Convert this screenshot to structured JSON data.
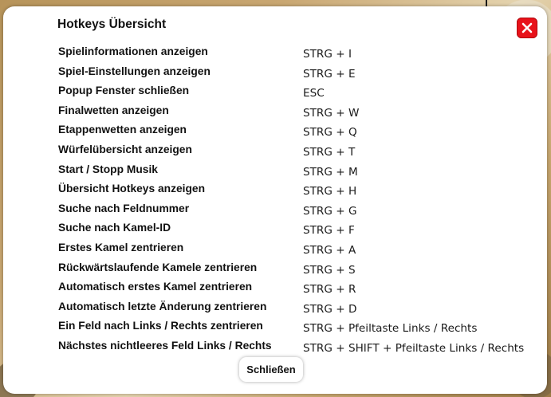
{
  "dialog": {
    "title": "Hotkeys Übersicht",
    "close_icon": "close-icon",
    "close_button_label": "Schließen",
    "accent_color": "#e8121a"
  },
  "hotkeys": [
    {
      "action": "Spielinformationen anzeigen",
      "keys": "STRG + I"
    },
    {
      "action": "Spiel-Einstellungen anzeigen",
      "keys": "STRG + E"
    },
    {
      "action": "Popup Fenster schließen",
      "keys": "ESC"
    },
    {
      "action": "Finalwetten anzeigen",
      "keys": "STRG + W"
    },
    {
      "action": "Etappenwetten anzeigen",
      "keys": "STRG + Q"
    },
    {
      "action": "Würfelübersicht anzeigen",
      "keys": "STRG + T"
    },
    {
      "action": "Start / Stopp Musik",
      "keys": "STRG + M"
    },
    {
      "action": "Übersicht Hotkeys anzeigen",
      "keys": "STRG + H"
    },
    {
      "action": "Suche nach Feldnummer",
      "keys": "STRG + G"
    },
    {
      "action": "Suche nach Kamel-ID",
      "keys": "STRG + F"
    },
    {
      "action": "Erstes Kamel zentrieren",
      "keys": "STRG + A"
    },
    {
      "action": "Rückwärtslaufende Kamele zentrieren",
      "keys": "STRG + S"
    },
    {
      "action": "Automatisch erstes Kamel zentrieren",
      "keys": "STRG + R"
    },
    {
      "action": "Automatisch letzte Änderung zentrieren",
      "keys": "STRG + D"
    },
    {
      "action": "Ein Feld nach Links / Rechts zentrieren",
      "keys": "STRG + Pfeiltaste Links / Rechts"
    },
    {
      "action": "Nächstes nichtleeres Feld Links / Rechts",
      "keys": "STRG + SHIFT + Pfeiltaste Links / Rechts"
    }
  ]
}
